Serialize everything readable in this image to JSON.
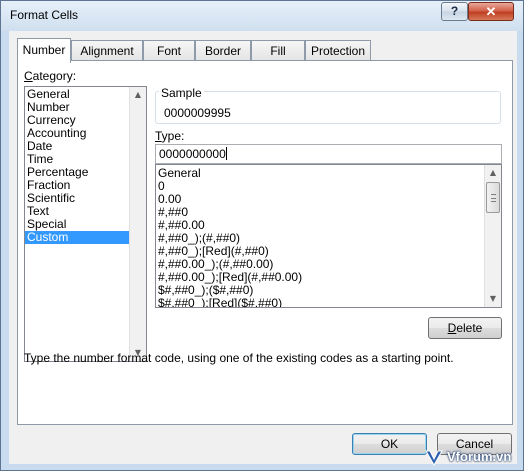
{
  "window": {
    "title": "Format Cells",
    "help_label": "?",
    "close_label": "✕"
  },
  "tabs": [
    {
      "label": "Number",
      "active": true
    },
    {
      "label": "Alignment",
      "active": false
    },
    {
      "label": "Font",
      "active": false
    },
    {
      "label": "Border",
      "active": false
    },
    {
      "label": "Fill",
      "active": false
    },
    {
      "label": "Protection",
      "active": false
    }
  ],
  "category": {
    "label_prefix": "C",
    "label_rest": "ategory:",
    "items": [
      "General",
      "Number",
      "Currency",
      "Accounting",
      "Date",
      "Time",
      "Percentage",
      "Fraction",
      "Scientific",
      "Text",
      "Special",
      "Custom"
    ],
    "selected": "Custom"
  },
  "sample": {
    "label": "Sample",
    "value": "0000009995"
  },
  "type": {
    "label_prefix": "T",
    "label_rest": "ype:",
    "input_value": "0000000000",
    "codes": [
      "General",
      "0",
      "0.00",
      "#,##0",
      "#,##0.00",
      "#,##0_);(#,##0)",
      "#,##0_);[Red](#,##0)",
      "#,##0.00_);(#,##0.00)",
      "#,##0.00_);[Red](#,##0.00)",
      "$#,##0_);($#,##0)",
      "$#,##0_);[Red]($#,##0)"
    ]
  },
  "delete_button": {
    "label_prefix": "D",
    "label_rest": "elete"
  },
  "description": "Type the number format code, using one of the existing codes as a starting point.",
  "footer": {
    "ok_label": "OK",
    "cancel_label": "Cancel"
  },
  "watermark": "Vforum.vn",
  "colors": {
    "selection": "#3399ff",
    "title_gradient_top": "#e6f0fa",
    "close_button_red": "#c13e22"
  },
  "icons": {
    "help": "question-mark",
    "close": "x-mark",
    "scroll_up": "triangle-up",
    "scroll_down": "triangle-down"
  }
}
